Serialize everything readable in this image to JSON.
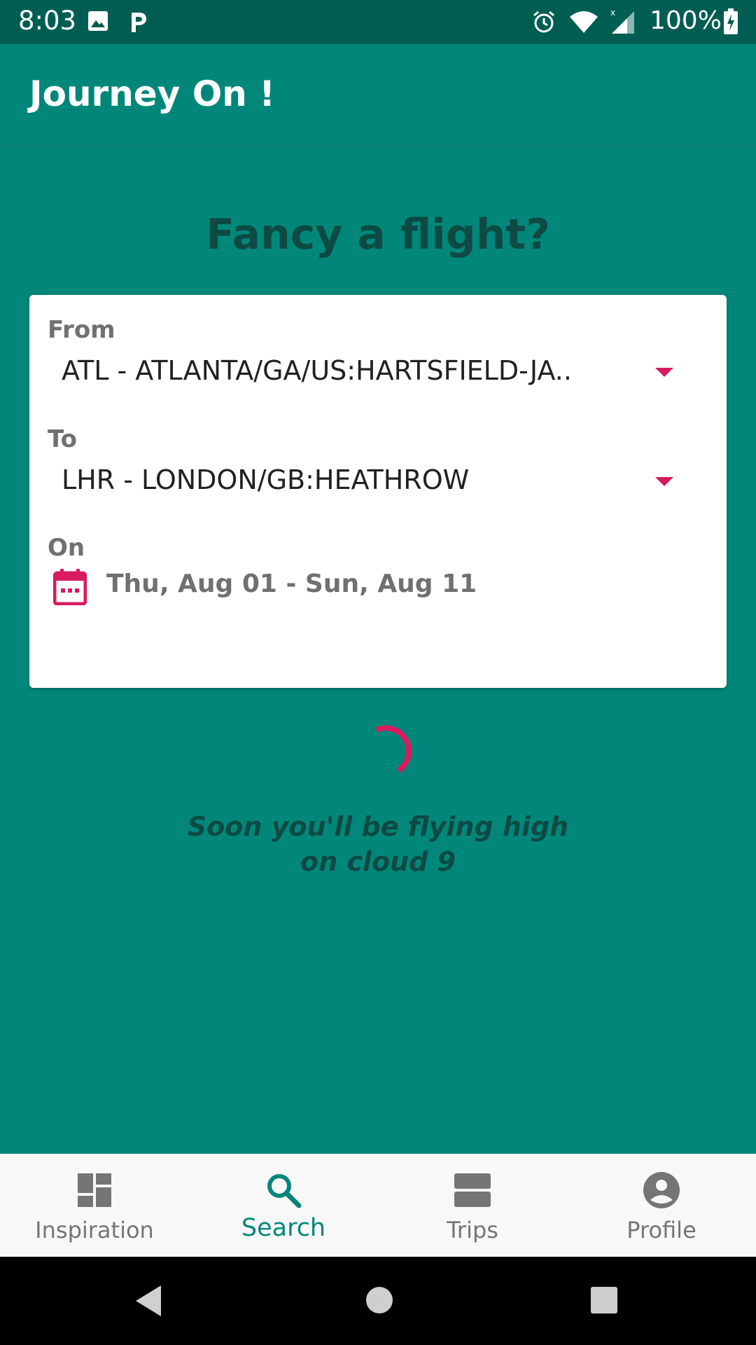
{
  "status_bar": {
    "time": "8:03",
    "battery": "100%",
    "icons": [
      "image-icon",
      "parking-icon",
      "alarm-icon",
      "wifi-icon",
      "signal-icon",
      "battery-charging-icon"
    ]
  },
  "app_bar": {
    "title": "Journey On !"
  },
  "heading": "Fancy a flight?",
  "search_form": {
    "from": {
      "label": "From",
      "value": "ATL - ATLANTA/GA/US:HARTSFIELD-JA.."
    },
    "to": {
      "label": "To",
      "value": "LHR - LONDON/GB:HEATHROW"
    },
    "on": {
      "label": "On",
      "value": "Thu, Aug 01 - Sun, Aug 11",
      "icon": "calendar-icon"
    }
  },
  "loading": {
    "line1": "Soon you'll be flying high",
    "line2": "on cloud 9"
  },
  "bottom_nav": {
    "items": [
      {
        "label": "Inspiration",
        "icon": "dashboard-icon",
        "active": false
      },
      {
        "label": "Search",
        "icon": "search-icon",
        "active": true
      },
      {
        "label": "Trips",
        "icon": "trips-icon",
        "active": false
      },
      {
        "label": "Profile",
        "icon": "profile-icon",
        "active": false
      }
    ]
  },
  "colors": {
    "primary": "#00877a",
    "primary_dark": "#005d52",
    "accent": "#d81b60",
    "heading_text": "#0d4a43"
  }
}
